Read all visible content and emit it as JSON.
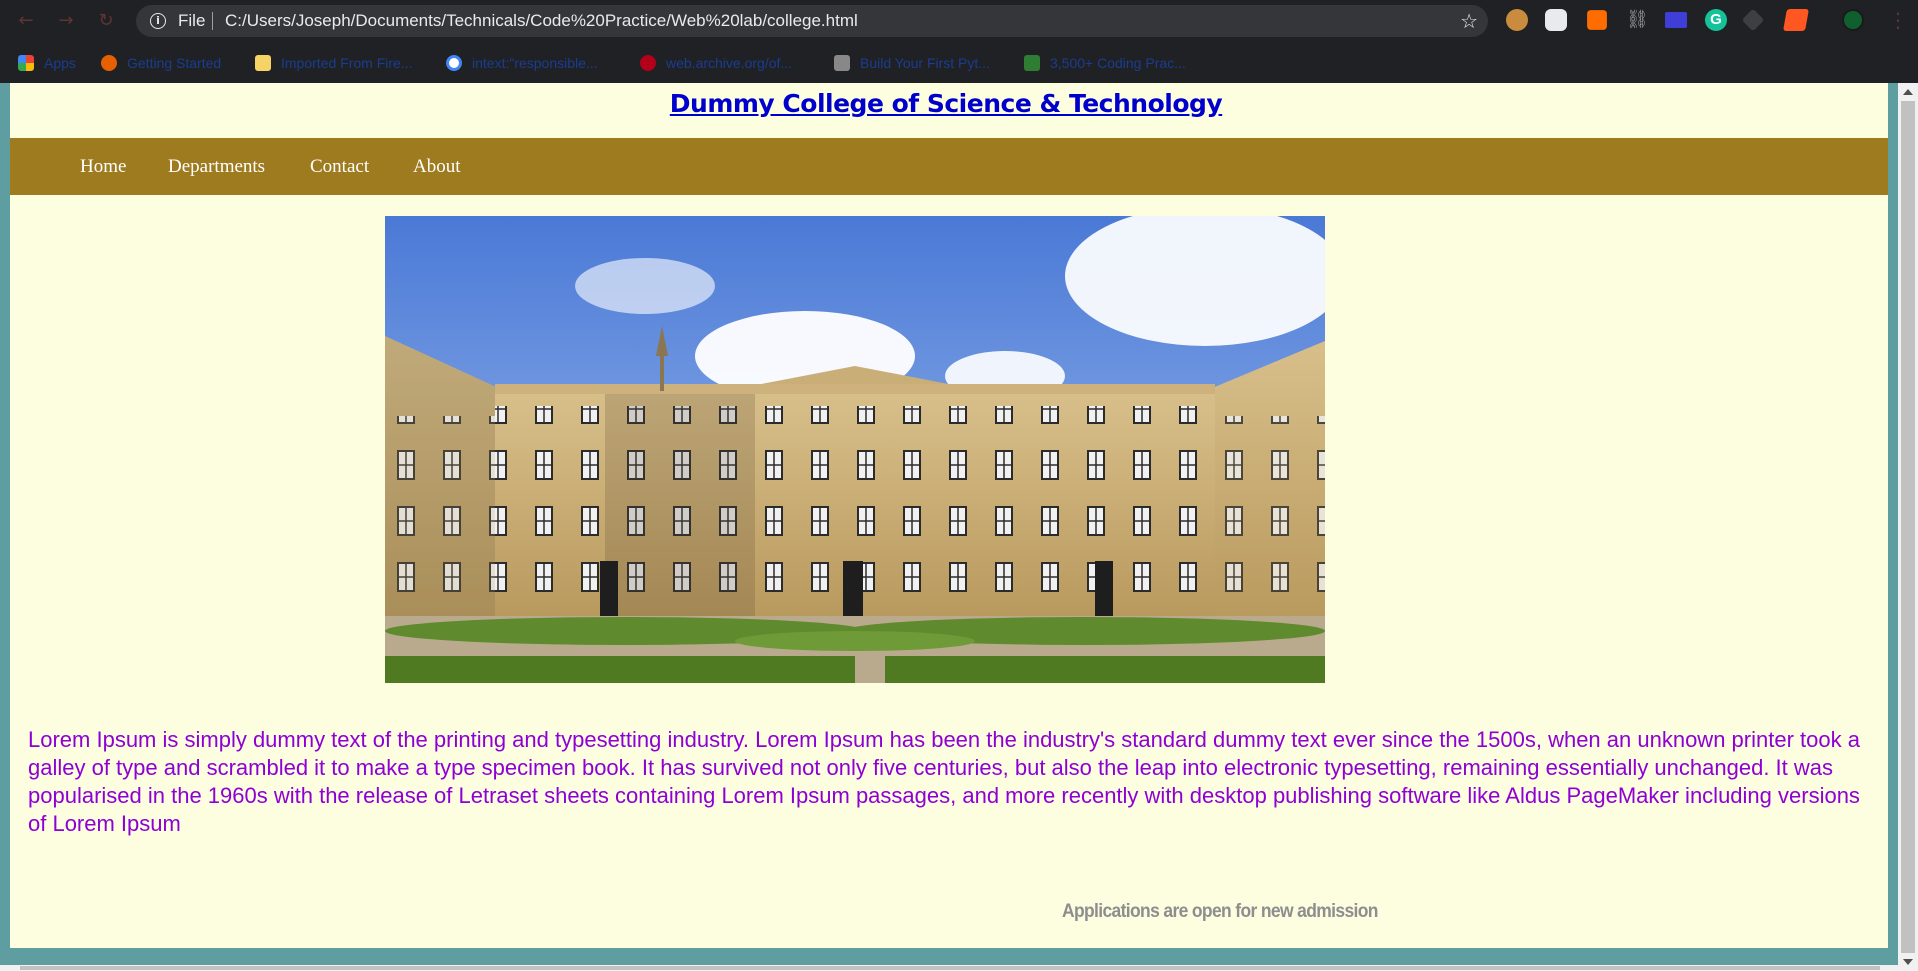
{
  "browser": {
    "scheme_label": "File",
    "url": "C:/Users/Joseph/Documents/Technicals/Code%20Practice/Web%20lab/college.html",
    "nav_icons": [
      "back-arrow-icon",
      "forward-arrow-icon",
      "reload-icon"
    ],
    "extensions": [
      "cookie-icon",
      "pen-icon",
      "ublock-icon",
      "link-icon",
      "monitor-icon",
      "grammarly-icon",
      "tag-icon",
      "bookmark-icon",
      "profile-avatar"
    ],
    "extension_labels": {
      "grammarly": "G"
    }
  },
  "bookmarks": [
    {
      "label": "Apps",
      "icon": "apps-icon"
    },
    {
      "label": "Getting Started",
      "icon": "firefox-icon"
    },
    {
      "label": "Imported From Fire...",
      "icon": "folder-icon"
    },
    {
      "label": "intext:\"responsible...",
      "icon": "google-icon"
    },
    {
      "label": "web.archive.org/of...",
      "icon": "archive-icon"
    },
    {
      "label": "Build Your First Pyt...",
      "icon": "python-icon"
    },
    {
      "label": "3,500+ Coding Prac...",
      "icon": "code-icon"
    }
  ],
  "site": {
    "title": "Dummy College of Science & Technology",
    "nav": [
      "Home",
      "Departments",
      "Contact",
      "About"
    ],
    "hero_alt": "college",
    "intro": "Lorem Ipsum is simply dummy text of the printing and typesetting industry. Lorem Ipsum has been the industry's standard dummy text ever since the 1500s, when an unknown printer took a galley of type and scrambled it to make a type specimen book. It has survived not only five centuries, but also the leap into electronic typesetting, remaining essentially unchanged. It was popularised in the 1960s with the release of Letraset sheets containing Lorem Ipsum passages, and more recently with desktop publishing software like Aldus PageMaker including versions of Lorem Ipsum",
    "notice": "Applications are open for new admission"
  },
  "colors": {
    "page_bg": "#fdfddf",
    "outer_bg": "#5f9ea0",
    "navbar_bg": "#9e7b1f",
    "title_link": "#0000cc",
    "intro_text": "#8f00d6",
    "notice_text": "#8e8e8e"
  }
}
